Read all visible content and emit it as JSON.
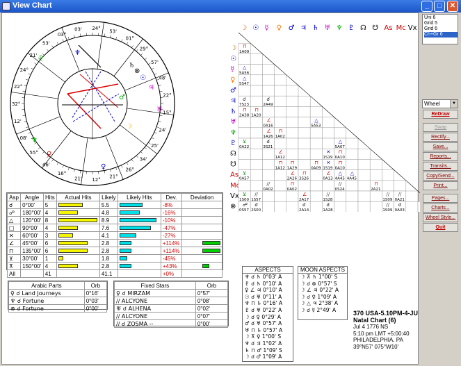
{
  "window": {
    "title": "View Chart",
    "min": "_",
    "max": "□",
    "close": "✕"
  },
  "wheel_labels": [
    "03'",
    "24°",
    "53'",
    "01°",
    "29°",
    "57'",
    "48'",
    "22°",
    "15°",
    "24'",
    "25'",
    "34'",
    "26°",
    "21°",
    "12°",
    "21'",
    "16°",
    "46'",
    "55°",
    "08'",
    "12'",
    "32°",
    "22°",
    "24°",
    "21'",
    "53'",
    "03°"
  ],
  "aspect_grid": {
    "planets": [
      "☽",
      "☉",
      "☿",
      "♀",
      "♂",
      "♃",
      "♄",
      "♅",
      "♆",
      "♇",
      "☊",
      "☋",
      "As",
      "Mc",
      "Vx",
      "⊗"
    ],
    "cells": [
      {
        "r": 1,
        "c": 0,
        "g": "⊓",
        "v": "1A09"
      },
      {
        "r": 1,
        "c": 2,
        "g": "//",
        "v": "0S43"
      },
      {
        "r": 1,
        "c": 3,
        "g": "//",
        "v": "0S46"
      },
      {
        "r": 1,
        "c": 4,
        "g": "//",
        "v": "0S27"
      },
      {
        "r": 1,
        "c": 8,
        "g": "//",
        "v": "0S55"
      },
      {
        "r": 1,
        "c": 10,
        "g": "//",
        "v": "1S06"
      },
      {
        "r": 2,
        "c": 10,
        "g": "//",
        "v": "0S54"
      },
      {
        "r": 2,
        "c": 11,
        "g": "//",
        "v": "0S54"
      },
      {
        "r": 3,
        "c": 0,
        "g": "△",
        "v": "5A56"
      },
      {
        "r": 3,
        "c": 3,
        "g": "//",
        "v": "0S16"
      },
      {
        "r": 3,
        "c": 4,
        "g": "//",
        "v": "0S15"
      },
      {
        "r": 3,
        "c": 8,
        "g": "//",
        "v": "0A11"
      },
      {
        "r": 4,
        "c": 0,
        "g": "△",
        "v": "5S47"
      },
      {
        "r": 4,
        "c": 4,
        "g": "//",
        "v": "0S18"
      },
      {
        "r": 4,
        "c": 8,
        "g": "//",
        "v": "0A09"
      },
      {
        "r": 5,
        "c": 8,
        "g": "//",
        "v": "0S27"
      },
      {
        "r": 5,
        "c": 12,
        "g": "//",
        "v": "0A57"
      },
      {
        "r": 6,
        "c": 0,
        "g": "☌",
        "v": "7S23"
      },
      {
        "r": 6,
        "c": 2,
        "g": "☌",
        "v": "2A49"
      },
      {
        "r": 7,
        "c": 0,
        "g": "⊓",
        "v": "2A38"
      },
      {
        "r": 7,
        "c": 1,
        "g": "⊓",
        "v": "1A20"
      },
      {
        "r": 7,
        "c": 8,
        "g": "//",
        "v": "0A30"
      },
      {
        "r": 8,
        "c": 2,
        "g": "∠",
        "v": "0A16"
      },
      {
        "r": 8,
        "c": 6,
        "g": "△",
        "v": "5A53"
      },
      {
        "r": 8,
        "c": 13,
        "g": "//",
        "v": "0A36"
      },
      {
        "r": 9,
        "c": 2,
        "g": "∠",
        "v": "1A26"
      },
      {
        "r": 9,
        "c": 3,
        "g": "⊓",
        "v": "1A02"
      },
      {
        "r": 10,
        "c": 0,
        "g": "⊻",
        "v": "0A22"
      },
      {
        "r": 10,
        "c": 2,
        "g": "☌",
        "v": "3S21"
      },
      {
        "r": 10,
        "c": 8,
        "g": "△",
        "v": "5A07"
      },
      {
        "r": 11,
        "c": 3,
        "g": "∠",
        "v": "1A12"
      },
      {
        "r": 11,
        "c": 7,
        "g": "✕",
        "v": "1S19"
      },
      {
        "r": 11,
        "c": 8,
        "g": "⊓",
        "v": "0A10"
      },
      {
        "r": 11,
        "c": 14,
        "g": "//",
        "v": "0A43"
      },
      {
        "r": 12,
        "c": 3,
        "g": "⊓",
        "v": "1A12"
      },
      {
        "r": 12,
        "c": 4,
        "g": "⊓",
        "v": "1A29"
      },
      {
        "r": 12,
        "c": 6,
        "g": "⊓",
        "v": "0A09"
      },
      {
        "r": 12,
        "c": 7,
        "g": "✕",
        "v": "1S19"
      },
      {
        "r": 12,
        "c": 8,
        "g": "⊓",
        "v": "0A10"
      },
      {
        "r": 12,
        "c": 14,
        "g": "//",
        "v": "0A43"
      },
      {
        "r": 13,
        "c": 0,
        "g": "⊻",
        "v": "0A57"
      },
      {
        "r": 13,
        "c": 4,
        "g": "∠",
        "v": "2A26"
      },
      {
        "r": 13,
        "c": 5,
        "g": "⊓",
        "v": "3S26"
      },
      {
        "r": 13,
        "c": 7,
        "g": "∠",
        "v": "0A13"
      },
      {
        "r": 13,
        "c": 8,
        "g": "△",
        "v": "4A45"
      },
      {
        "r": 13,
        "c": 9,
        "g": "△",
        "v": "4A45"
      },
      {
        "r": 14,
        "c": 2,
        "g": "//",
        "v": "0A02"
      },
      {
        "r": 14,
        "c": 4,
        "g": "⊓",
        "v": "0A02"
      },
      {
        "r": 14,
        "c": 8,
        "g": "//",
        "v": "0S24"
      },
      {
        "r": 14,
        "c": 11,
        "g": "⊓",
        "v": "2A21"
      },
      {
        "r": 15,
        "c": 0,
        "g": "⊻",
        "v": "1S00"
      },
      {
        "r": 15,
        "c": 1,
        "g": "//",
        "v": "1S57"
      },
      {
        "r": 15,
        "c": 5,
        "g": "∠",
        "v": "2A17"
      },
      {
        "r": 15,
        "c": 7,
        "g": "//",
        "v": "1S28"
      },
      {
        "r": 15,
        "c": 12,
        "g": "//",
        "v": "1S09"
      },
      {
        "r": 15,
        "c": 13,
        "g": "//",
        "v": "0A21"
      },
      {
        "r": 16,
        "c": 0,
        "g": "☍",
        "v": "0S57"
      },
      {
        "r": 16,
        "c": 1,
        "g": "☌",
        "v": "2S00"
      },
      {
        "r": 16,
        "c": 5,
        "g": "☌",
        "v": "2A14"
      },
      {
        "r": 16,
        "c": 7,
        "g": "☌",
        "v": "1A28"
      },
      {
        "r": 16,
        "c": 12,
        "g": "//",
        "v": "1S09"
      },
      {
        "r": 16,
        "c": 13,
        "g": "☌",
        "v": "0A03"
      }
    ]
  },
  "asp_table": {
    "headers": [
      "Asp",
      "Angle",
      "Hits",
      "Actual Hits",
      "Likely",
      "Likely Hits",
      "Dev.",
      "Deviation"
    ],
    "rows": [
      {
        "asp": "☌",
        "angle": "0°00'",
        "hits": "5",
        "likely": "5.5",
        "dev": "-8%",
        "actual": 5,
        "lik": 5.5,
        "devv": -8
      },
      {
        "asp": "☍",
        "angle": "180°00'",
        "hits": "4",
        "likely": "4.8",
        "dev": "-16%",
        "actual": 4,
        "lik": 4.8,
        "devv": -16
      },
      {
        "asp": "△",
        "angle": "120°00'",
        "hits": "8",
        "likely": "8.9",
        "dev": "-10%",
        "actual": 8,
        "lik": 8.9,
        "devv": -10
      },
      {
        "asp": "□",
        "angle": "90°00'",
        "hits": "4",
        "likely": "7.6",
        "dev": "-47%",
        "actual": 4,
        "lik": 7.6,
        "devv": -47
      },
      {
        "asp": "✕",
        "angle": "60°00'",
        "hits": "3",
        "likely": "4.1",
        "dev": "-27%",
        "actual": 3,
        "lik": 4.1,
        "devv": -27
      },
      {
        "asp": "∠",
        "angle": "45°00'",
        "hits": "6",
        "likely": "2.8",
        "dev": "+114%",
        "actual": 6,
        "lik": 2.8,
        "devv": 114
      },
      {
        "asp": "⊓",
        "angle": "135°00'",
        "hits": "6",
        "likely": "2.8",
        "dev": "+114%",
        "actual": 6,
        "lik": 2.8,
        "devv": 114
      },
      {
        "asp": "⊻",
        "angle": "30°00'",
        "hits": "1",
        "likely": "1.8",
        "dev": "-45%",
        "actual": 1,
        "lik": 1.8,
        "devv": -45
      },
      {
        "asp": "⊼",
        "angle": "150°00'",
        "hits": "4",
        "likely": "2.8",
        "dev": "+43%",
        "actual": 4,
        "lik": 2.8,
        "devv": 43
      }
    ],
    "total": {
      "asp": "All",
      "hits": "41",
      "likely": "41.1",
      "dev": "+0%"
    }
  },
  "arabic_parts": {
    "headers": [
      "Arabic Parts",
      "Orb"
    ],
    "rows": [
      {
        "g": "♀ ☌ Land Journeys",
        "orb": "0°16'"
      },
      {
        "g": "♆ ☌ Fortune",
        "orb": "0°03'"
      },
      {
        "g": "⊗ ☌ Fortune",
        "orb": "0°00'"
      }
    ]
  },
  "fixed_stars": {
    "headers": [
      "Fixed Stars",
      "Orb"
    ],
    "rows": [
      {
        "g": "♀ ☌ MIRZAM",
        "orb": "0°57'"
      },
      {
        "g": "// ALCYONE",
        "orb": "0°08'"
      },
      {
        "g": "♅ ☌ ALHENA",
        "orb": "0°02'"
      },
      {
        "g": "// ALCYONE",
        "orb": "0°07'"
      },
      {
        "g": "// ☌ ZOSMA --",
        "orb": "0°00'"
      }
    ]
  },
  "aspects": {
    "title": "ASPECTS",
    "rows": [
      "♆ ☌ ♄ 0°03' A",
      "♇ ☌ ♄ 0°10' A",
      "♀ ∠ ♃ 0°10' A",
      "☉ ☌ ♅ 0°11' A",
      "♆ ⊓ ♄ 0°16' A",
      "♇ ☌ ♅ 0°22' A",
      "☽ ☌ ♀ 0°29' A",
      "♂ ☌ ♅ 0°57' A",
      "♅ ⊓ ♄ 0°57' A",
      "☽ ⊼ ♀ 1°00' S",
      "♆ ☌ ♃ 1°02' A",
      "♄ ⊓ ♂ 1°09' S",
      "☽ ☌ ♂ 1°09' A"
    ]
  },
  "moon_aspects": {
    "title": "MOON ASPECTS",
    "rows": [
      "☽ ⊼ ♄ 1°00' S",
      "☽ ☌ ⊗ 0°57' S",
      "☽ ∠ ♃ 0°22' A",
      "☽ ☌ ♀ 1°09' A",
      "☽ △ ♃ 2°38' A",
      "☽ ☌ ☿ 2°49' A"
    ]
  },
  "natal": {
    "line1": "370 USA-5.10PM-4-JU",
    "line2": "Natal Chart (6)",
    "line3": "Jul 4 1776 NS",
    "line4": "5:10 pm  LMT +5:00:40",
    "line5": "PHILADELPHIA, PA",
    "line6": "39°N57' 075°W10'"
  },
  "listbox": [
    "Uni 6",
    "Grid 5",
    "Grid 6",
    "Ch+Gr 6"
  ],
  "wheel_dropdown": "Wheel",
  "buttons": [
    "ReDraw",
    "Swap",
    "Rectify...",
    "Save...",
    "Reports...",
    "Transits...",
    "Copy/Send...",
    "Print...",
    "Pages...",
    "Charts...",
    "Wheel Style...",
    "Quit"
  ],
  "colors": {
    "accent": "#2b63c7",
    "red": "#d00000",
    "bar_yellow": "#f5f500",
    "bar_cyan": "#00e0e8",
    "bar_green": "#00d000"
  }
}
